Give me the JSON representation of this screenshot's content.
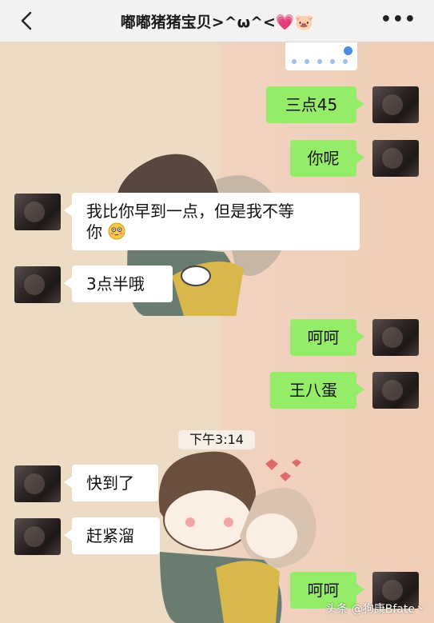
{
  "header": {
    "title": "嘟嘟猪猪宝贝>^ω^<💗🐷",
    "back_icon": "chevron-left-icon",
    "more_icon": "more-horizontal-icon"
  },
  "messages": [
    {
      "side": "right",
      "text": "三点45"
    },
    {
      "side": "right",
      "text": "你呢"
    },
    {
      "side": "left",
      "text": "我比你早到一点，但是我不等"
    },
    {
      "side": "left",
      "text": "你",
      "emoji": "flushed-face-icon"
    },
    {
      "side": "left",
      "text": "3点半哦"
    },
    {
      "side": "right",
      "text": "呵呵"
    },
    {
      "side": "right",
      "text": "王八蛋"
    },
    {
      "side": "left",
      "text": "快到了"
    },
    {
      "side": "left",
      "text": "赶紧溜"
    },
    {
      "side": "right",
      "text": "呵呵"
    }
  ],
  "timestamp": "下午3:14",
  "watermark": "头条 @狗康Bfate丶",
  "colors": {
    "bubble_right": "#95ec69",
    "bubble_left": "#ffffff",
    "header_bg": "#f4f2f1"
  }
}
